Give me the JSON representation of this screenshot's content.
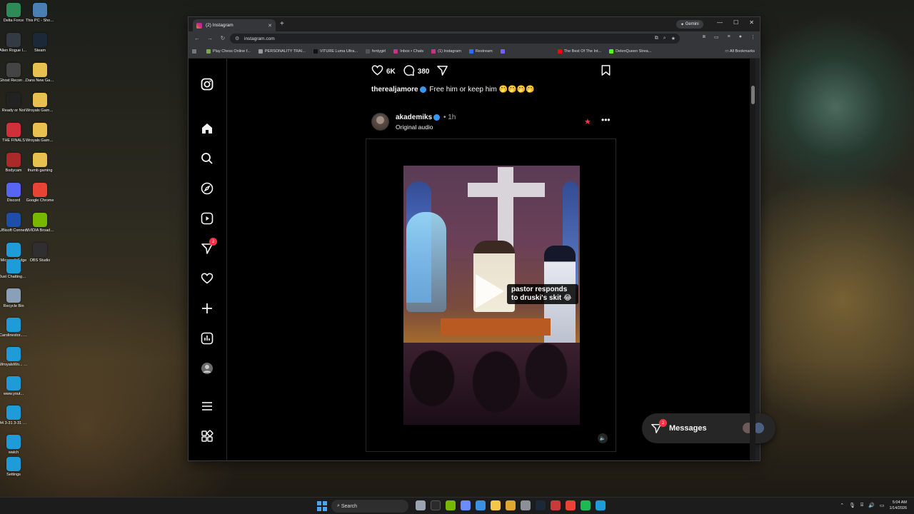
{
  "desktop": {
    "icons": [
      {
        "label": "Delta Force",
        "color": "#2e8b57"
      },
      {
        "label": "This PC - Shortcut",
        "color": "#4a7fb5"
      },
      {
        "label": "Allen Rogue Incursion ...",
        "color": "#333a44"
      },
      {
        "label": "Steam",
        "color": "#1b2838"
      },
      {
        "label": "Ghost Recon Breakpoint",
        "color": "#444444"
      },
      {
        "label": "Dans New Gaming PICS",
        "color": "#e8c04f"
      },
      {
        "label": "Ready or Not",
        "color": "#222222"
      },
      {
        "label": "Wroyals Games 2",
        "color": "#e8c04f"
      },
      {
        "label": "THE FINALS",
        "color": "#d0303a"
      },
      {
        "label": "Wroyals Games 4",
        "color": "#e8c04f"
      },
      {
        "label": "Bodycam",
        "color": "#aa2a2a"
      },
      {
        "label": "thumb gaming",
        "color": "#e8c04f"
      },
      {
        "label": "Discord",
        "color": "#5865f2"
      },
      {
        "label": "Google Chrome",
        "color": "#e94335"
      },
      {
        "label": "UBisoft Connect",
        "color": "#1f4ea8"
      },
      {
        "label": "NVIDIA Broadcast",
        "color": "#76b900"
      },
      {
        "label": "Microsoft Edge",
        "color": "#1e9cd7"
      },
      {
        "label": "OBS Studio",
        "color": "#302e31"
      },
      {
        "label": "Just ChattingWi...",
        "color": "#1e9cd7"
      },
      {
        "label": "Recycle Bin",
        "color": "#8aa0b8"
      },
      {
        "label": "Carolinestor... ChattingUv...",
        "color": "#1e9cd7"
      },
      {
        "label": "WroyalsWo... Wercyelse...",
        "color": "#1e9cd7"
      },
      {
        "label": "www.yout...",
        "color": "#1e9cd7"
      },
      {
        "label": "44 3-31 3-31 Now playin...",
        "color": "#1e9cd7"
      },
      {
        "label": "watch",
        "color": "#1e9cd7"
      },
      {
        "label": "Settings",
        "color": "#1e9cd7"
      }
    ]
  },
  "browser": {
    "tab_title": "(2) Instagram",
    "gemini_label": "Gemini",
    "url": "instagram.com",
    "bookmarks": [
      {
        "label": "Play Chess Online f...",
        "color": "#7fa650"
      },
      {
        "label": "PERSONALITY TRAI...",
        "color": "#999999"
      },
      {
        "label": "VITURE Luma Ultra...",
        "color": "#111111"
      },
      {
        "label": "fentygirl",
        "color": "#555555"
      },
      {
        "label": "Inbox • Chats",
        "color": "#c13584"
      },
      {
        "label": "(1) Instagram",
        "color": "#c13584"
      },
      {
        "label": "Restream",
        "color": "#2b6ef5"
      },
      {
        "label": "",
        "color": "#7b5cff"
      },
      {
        "label": "The Best Of The Int...",
        "color": "#ff0000"
      },
      {
        "label": "DelenQueen Strea...",
        "color": "#53fc18"
      }
    ],
    "all_bookmarks": "All Bookmarks"
  },
  "instagram": {
    "sidebar_badge": "2",
    "post_prev": {
      "likes": "6K",
      "comments": "380",
      "caption_user": "therealjamore",
      "caption_text": "Free him or keep him 🤭🤭🤭🤭"
    },
    "post": {
      "username": "akademiks",
      "time": "• 1h",
      "audio": "Original audio",
      "overlay_text": "pastor responds to druski's skit 😂"
    },
    "messages": {
      "label": "Messages",
      "badge": "2"
    }
  },
  "taskbar": {
    "search_placeholder": "Search",
    "time": "5:04 AM",
    "date": "1/14/2026"
  }
}
